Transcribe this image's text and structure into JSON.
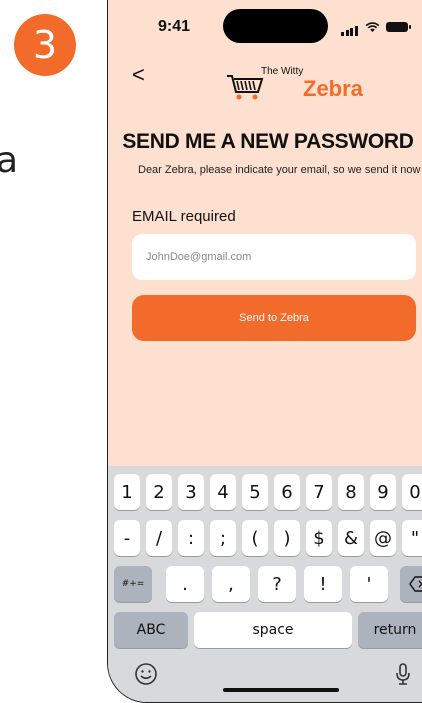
{
  "step_number": "3",
  "background_fragment": "a",
  "status_bar": {
    "time": "9:41"
  },
  "header": {
    "back_label": "<",
    "logo_small": "The Witty",
    "logo_big": "Zebra"
  },
  "page": {
    "title": "SEND ME A NEW PASSWORD",
    "subtitle": "Dear Zebra, please indicate your email,  so we send it now",
    "field_label": "EMAIL required",
    "email_placeholder": "JohnDoe@gmail.com",
    "send_button": "Send to Zebra"
  },
  "keyboard": {
    "row1": [
      "1",
      "2",
      "3",
      "4",
      "5",
      "6",
      "7",
      "8",
      "9",
      "0"
    ],
    "row2": [
      "-",
      "/",
      ":",
      ";",
      "(",
      ")",
      "$",
      "&",
      "@",
      "\""
    ],
    "row3": [
      ".",
      ",",
      "?",
      "!",
      "'"
    ],
    "symbols_key": "#+=",
    "abc_key": "ABC",
    "space_key": "space",
    "return_key": "return"
  },
  "colors": {
    "accent": "#f26b2a",
    "phone_bg": "#fde0cf",
    "keyboard_bg": "#d8d9dd"
  }
}
